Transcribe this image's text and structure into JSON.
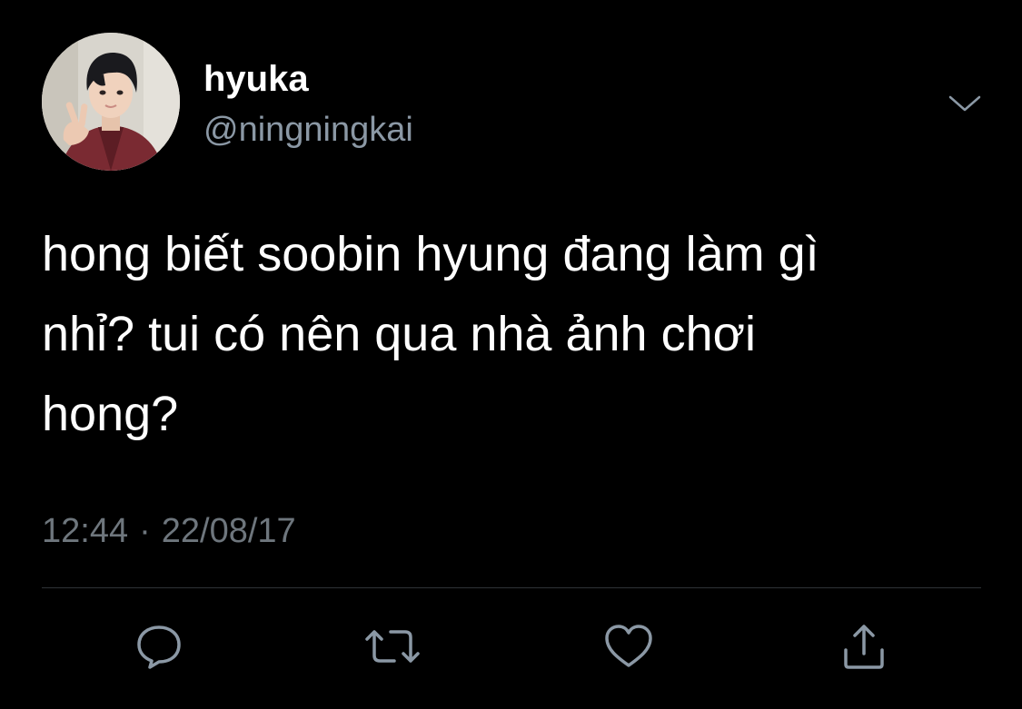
{
  "user": {
    "display_name": "hyuka",
    "handle": "@ningningkai"
  },
  "tweet": {
    "text": "hong biết soobin hyung đang làm gì\nnhỉ? tui có nên qua nhà ảnh chơi\nhong?",
    "time": "12:44",
    "separator": "·",
    "date": "22/08/17"
  },
  "icons": {
    "more": "chevron-down-icon",
    "reply": "reply-bubble-icon",
    "retweet": "retweet-icon",
    "like": "heart-icon",
    "share": "share-upload-icon"
  },
  "colors": {
    "background": "#000000",
    "text": "#ffffff",
    "secondary_text": "#8b98a5",
    "icon": "#8b98a5",
    "divider": "#2f3336"
  }
}
